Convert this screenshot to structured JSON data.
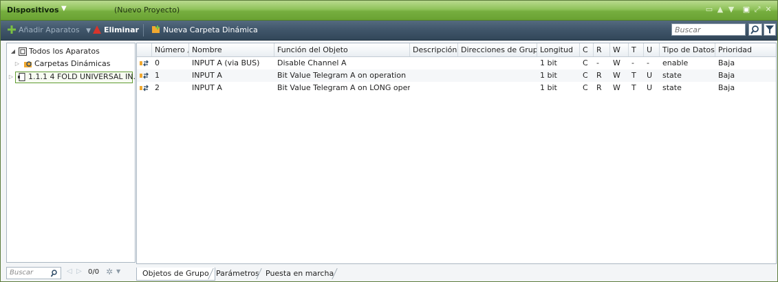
{
  "titlebar": {
    "title": "Dispositivos",
    "project": "(Nuevo Proyecto)"
  },
  "toolbar": {
    "add_label": "Añadir Aparatos",
    "delete_label": "Eliminar",
    "new_folder_label": "Nueva Carpeta Dinámica",
    "search_placeholder": "Buscar"
  },
  "tree": {
    "root": "Todos los Aparatos",
    "items": [
      {
        "label": "Carpetas Dinámicas"
      },
      {
        "label": "1.1.1  4 FOLD UNIVERSAL IN..."
      }
    ]
  },
  "left_nav": {
    "search_placeholder": "Buscar",
    "counter": "0/0"
  },
  "table": {
    "columns": [
      "Número",
      "Nombre",
      "Función del Objeto",
      "Descripción",
      "Direcciones de Grupo",
      "Longitud",
      "C",
      "R",
      "W",
      "T",
      "U",
      "Tipo de Datos",
      "Prioridad"
    ],
    "rows": [
      [
        "0",
        "INPUT A (via BUS)",
        "Disable Channel A",
        "",
        "",
        "1 bit",
        "C",
        "-",
        "W",
        "-",
        "-",
        "enable",
        "Baja"
      ],
      [
        "1",
        "INPUT A",
        "Bit Value Telegram A on operation",
        "",
        "",
        "1 bit",
        "C",
        "R",
        "W",
        "T",
        "U",
        "state",
        "Baja"
      ],
      [
        "2",
        "INPUT A",
        "Bit Value Telegram A on  LONG operation",
        "",
        "",
        "1 bit",
        "C",
        "R",
        "W",
        "T",
        "U",
        "state",
        "Baja"
      ]
    ]
  },
  "tabs": [
    "Objetos de Grupo",
    "Parámetros",
    "Puesta en marcha"
  ],
  "colors": {
    "titlebar_green": "#76ae3f",
    "toolbar_dark": "#3f5569",
    "selected_border": "#5e9b2f"
  }
}
